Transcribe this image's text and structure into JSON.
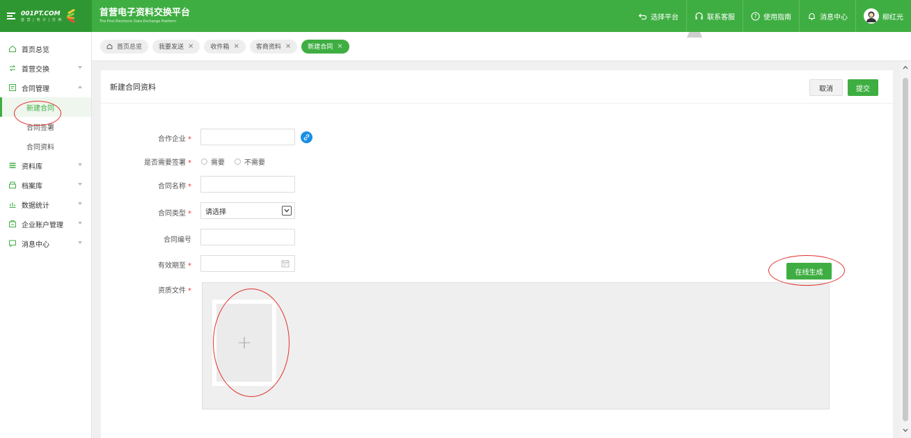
{
  "header": {
    "logo_text": "001PT.COM",
    "logo_sub": "首 营 | 电 子 | 交 换",
    "title": "首营电子资料交换平台",
    "subtitle": "The First Electronic Data Exchange Platform",
    "actions": [
      {
        "label": "选择平台",
        "icon": "return-icon"
      },
      {
        "label": "联系客服",
        "icon": "headset-icon"
      },
      {
        "label": "使用指南",
        "icon": "help-icon"
      },
      {
        "label": "消息中心",
        "icon": "bell-icon"
      }
    ],
    "user_name": "柳红光"
  },
  "sidebar": {
    "items": [
      {
        "label": "首页总览",
        "icon": "home-icon"
      },
      {
        "label": "首营交换",
        "icon": "exchange-icon"
      },
      {
        "label": "合同管理",
        "icon": "contract-icon"
      },
      {
        "label": "资料库",
        "icon": "library-icon"
      },
      {
        "label": "档案库",
        "icon": "archive-icon"
      },
      {
        "label": "数据统计",
        "icon": "stats-icon"
      },
      {
        "label": "企业账户管理",
        "icon": "account-icon"
      },
      {
        "label": "消息中心",
        "icon": "message-icon"
      }
    ],
    "contract_sub": [
      "新建合同",
      "合同签署",
      "合同资料"
    ]
  },
  "tabs": [
    {
      "label": "首页总览",
      "closable": false,
      "active": false
    },
    {
      "label": "我要发送",
      "closable": true,
      "active": false
    },
    {
      "label": "收件箱",
      "closable": true,
      "active": false
    },
    {
      "label": "客商资料",
      "closable": true,
      "active": false
    },
    {
      "label": "新建合同",
      "closable": true,
      "active": true
    }
  ],
  "tab_close": "×",
  "page": {
    "title": "新建合同资料",
    "cancel_label": "取消",
    "submit_label": "提交"
  },
  "form": {
    "partner_label": "合作企业",
    "partner_value": "",
    "sign_label": "是否需要签署",
    "sign_options": [
      "需要",
      "不需要"
    ],
    "name_label": "合同名称",
    "name_value": "",
    "type_label": "合同类型",
    "type_selected": "请选择",
    "number_label": "合同编号",
    "number_value": "",
    "expiry_label": "有效期至",
    "expiry_value": "",
    "files_label": "资质文件",
    "required_mark": "*",
    "upload_plus": "+",
    "generate_label": "在线生成"
  },
  "colors": {
    "brand_green": "#3fae42",
    "link_blue": "#1a8fe3",
    "required_red": "#e33333",
    "annotation_red": "#e0302a"
  }
}
